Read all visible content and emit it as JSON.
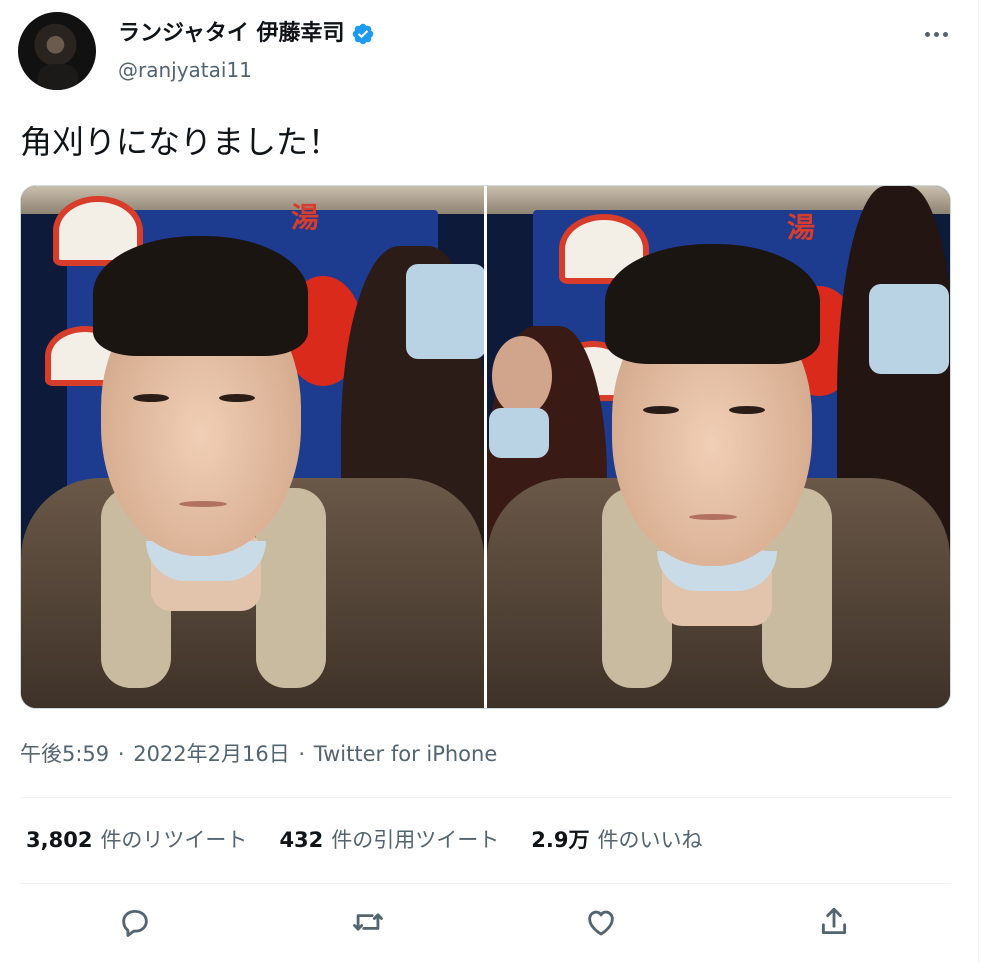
{
  "author": {
    "display_name": "ランジャタイ 伊藤幸司",
    "handle": "@ranjyatai11",
    "verified": true
  },
  "tweet": {
    "text": "角刈りになりました！",
    "photos": [
      "photo-1",
      "photo-2"
    ]
  },
  "meta": {
    "time": "午後5:59",
    "sep1": " · ",
    "date": "2022年2月16日",
    "sep2": " · ",
    "source": "Twitter for iPhone"
  },
  "stats": {
    "retweets": {
      "count": "3,802",
      "label": "件のリツイート"
    },
    "quotes": {
      "count": "432",
      "label": "件の引用ツイート"
    },
    "likes": {
      "count": "2.9万",
      "label": "件のいいね"
    }
  },
  "icons": {
    "more": "more-icon",
    "reply": "reply-icon",
    "retweet": "retweet-icon",
    "like": "heart-icon",
    "share": "share-icon"
  },
  "colors": {
    "text": "#0f1419",
    "secondary": "#536471",
    "verified": "#1d9bf0",
    "border": "#eff3f4"
  },
  "banner_text": {
    "kanji_1": "湯",
    "kanji_2": "湯"
  }
}
